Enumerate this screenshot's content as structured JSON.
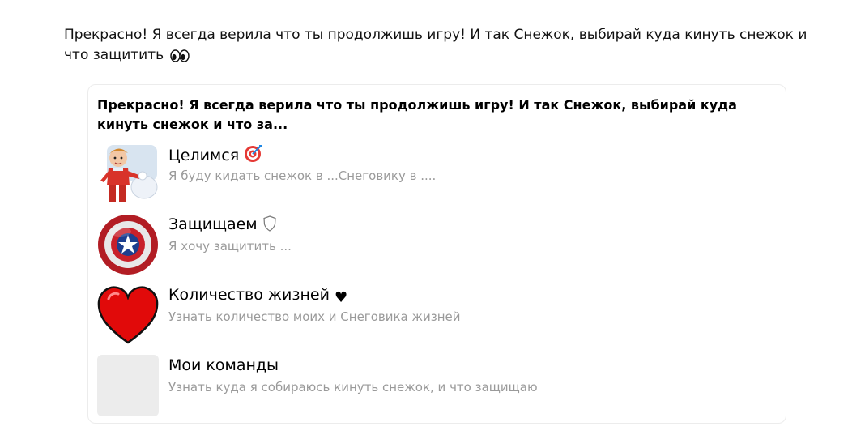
{
  "message": {
    "text": "Прекрасно! Я всегда верила что ты продолжишь игру! И так Снежок, выбирай куда кинуть снежок и что защитить",
    "emoji": "eyes-emoji"
  },
  "card": {
    "title": "Прекрасно! Я всегда верила что ты продолжишь игру! И так Снежок, выбирай куда кинуть снежок и что за...",
    "items": [
      {
        "title": "Целимся",
        "title_emoji": "target-emoji",
        "subtitle": "Я буду кидать снежок в ...Снеговику в ....",
        "thumb": "boy-throwing-snowball-image"
      },
      {
        "title": "Защищаем",
        "title_emoji": "shield-emoji",
        "title_emoji_char": "🛡",
        "subtitle": "Я хочу защитить ...",
        "thumb": "captain-shield-image"
      },
      {
        "title": "Количество жизней",
        "title_emoji": "heart-emoji",
        "title_emoji_char": "♥",
        "subtitle": "Узнать количество моих и Снеговика жизней",
        "thumb": "red-heart-image"
      },
      {
        "title": "Мои команды",
        "subtitle": "Узнать куда я собираюсь кинуть снежок, и что защищаю",
        "thumb": "empty-placeholder-image"
      }
    ]
  },
  "colors": {
    "text": "#000000",
    "subtitle": "#9a9a9a",
    "card_border": "#ececec",
    "placeholder": "#ececec",
    "heart": "#e10a0a",
    "shield_red": "#c8202a",
    "shield_blue": "#1d3f8f"
  }
}
